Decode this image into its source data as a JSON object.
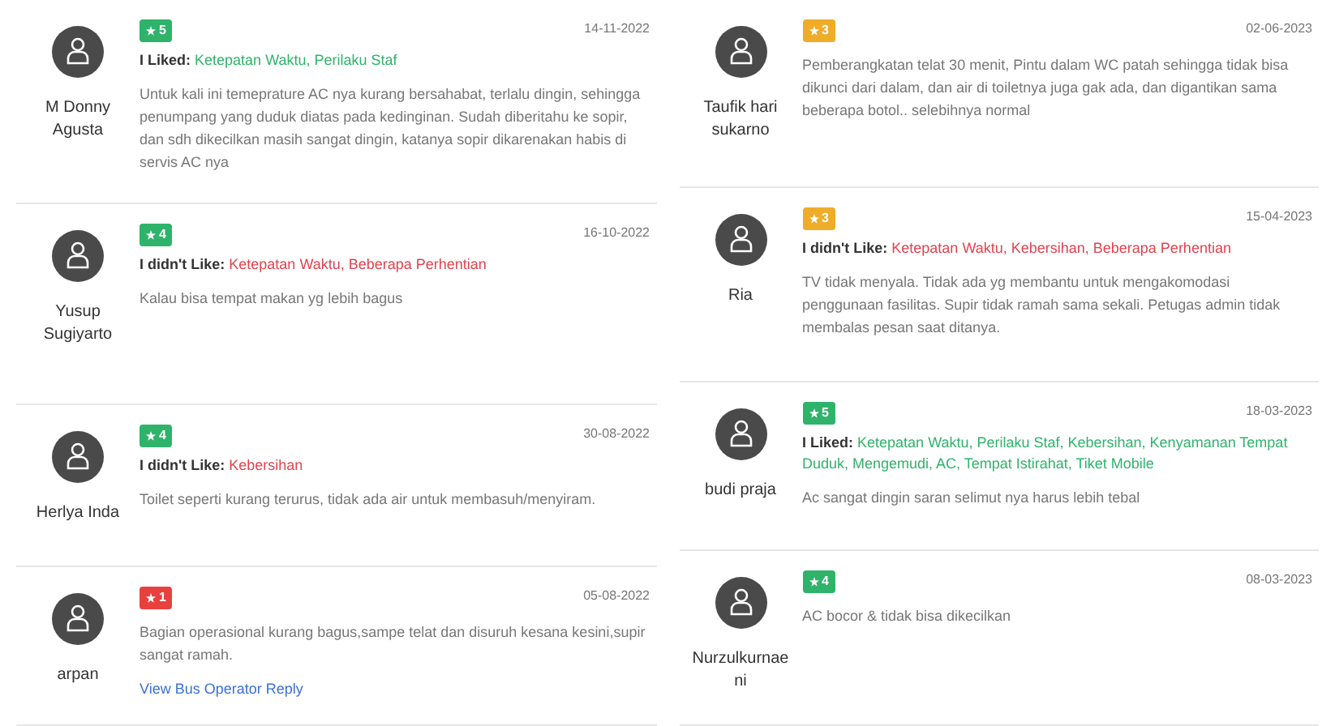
{
  "columns": [
    {
      "reviews": [
        {
          "name": "M Donny Agusta",
          "rating": "5",
          "color": "#2fb36b",
          "date": "14-11-2022",
          "feedback": {
            "kind": "liked",
            "label": "I Liked:",
            "items": "Ketepatan Waktu, Perilaku Staf"
          },
          "text": "Untuk kali ini temeprature AC nya kurang bersahabat, terlalu dingin, sehingga penumpang yang duduk diatas pada kedinginan. Sudah diberitahu ke sopir, dan sdh dikecilkan masih sangat dingin, katanya sopir dikarenakan habis di servis AC nya"
        },
        {
          "name": "Yusup Sugiyarto",
          "rating": "4",
          "color": "#2fb36b",
          "date": "16-10-2022",
          "feedback": {
            "kind": "disliked",
            "label": "I didn't Like:",
            "items": "Ketepatan Waktu, Beberapa Perhentian"
          },
          "text": "Kalau bisa tempat makan yg lebih bagus"
        },
        {
          "name": "Herlya Inda",
          "rating": "4",
          "color": "#2fb36b",
          "date": "30-08-2022",
          "feedback": {
            "kind": "disliked",
            "label": "I didn't Like:",
            "items": "Kebersihan"
          },
          "text": "Toilet seperti kurang terurus, tidak ada air untuk membasuh/menyiram."
        },
        {
          "name": "arpan",
          "rating": "1",
          "color": "#e8403f",
          "date": "05-08-2022",
          "text": "Bagian operasional kurang bagus,sampe telat dan disuruh kesana kesini,supir sangat ramah.",
          "reply_link": "View Bus Operator Reply"
        }
      ]
    },
    {
      "reviews": [
        {
          "name": "Taufik hari sukarno",
          "rating": "3",
          "color": "#eeac28",
          "date": "02-06-2023",
          "text": "Pemberangkatan telat 30 menit, Pintu dalam WC patah sehingga tidak bisa dikunci dari dalam, dan air di toiletnya juga gak ada, dan digantikan sama beberapa botol.. selebihnya normal"
        },
        {
          "name": "Ria",
          "rating": "3",
          "color": "#eeac28",
          "date": "15-04-2023",
          "feedback": {
            "kind": "disliked",
            "label": "I didn't Like:",
            "items": "Ketepatan Waktu, Kebersihan, Beberapa Perhentian"
          },
          "text": "TV tidak menyala. Tidak ada yg membantu untuk mengakomodasi penggunaan fasilitas. Supir tidak ramah sama sekali. Petugas admin tidak membalas pesan saat ditanya."
        },
        {
          "name": "budi praja",
          "rating": "5",
          "color": "#2fb36b",
          "date": "18-03-2023",
          "feedback": {
            "kind": "liked",
            "label": "I Liked:",
            "items": "Ketepatan Waktu, Perilaku Staf, Kebersihan, Kenyamanan Tempat Duduk, Mengemudi, AC, Tempat Istirahat, Tiket Mobile"
          },
          "text": "Ac sangat dingin saran selimut nya harus lebih tebal"
        },
        {
          "name": "Nurzulkurnaeni",
          "rating": "4",
          "color": "#2fb36b",
          "date": "08-03-2023",
          "text": "AC bocor & tidak bisa dikecilkan"
        }
      ]
    }
  ]
}
